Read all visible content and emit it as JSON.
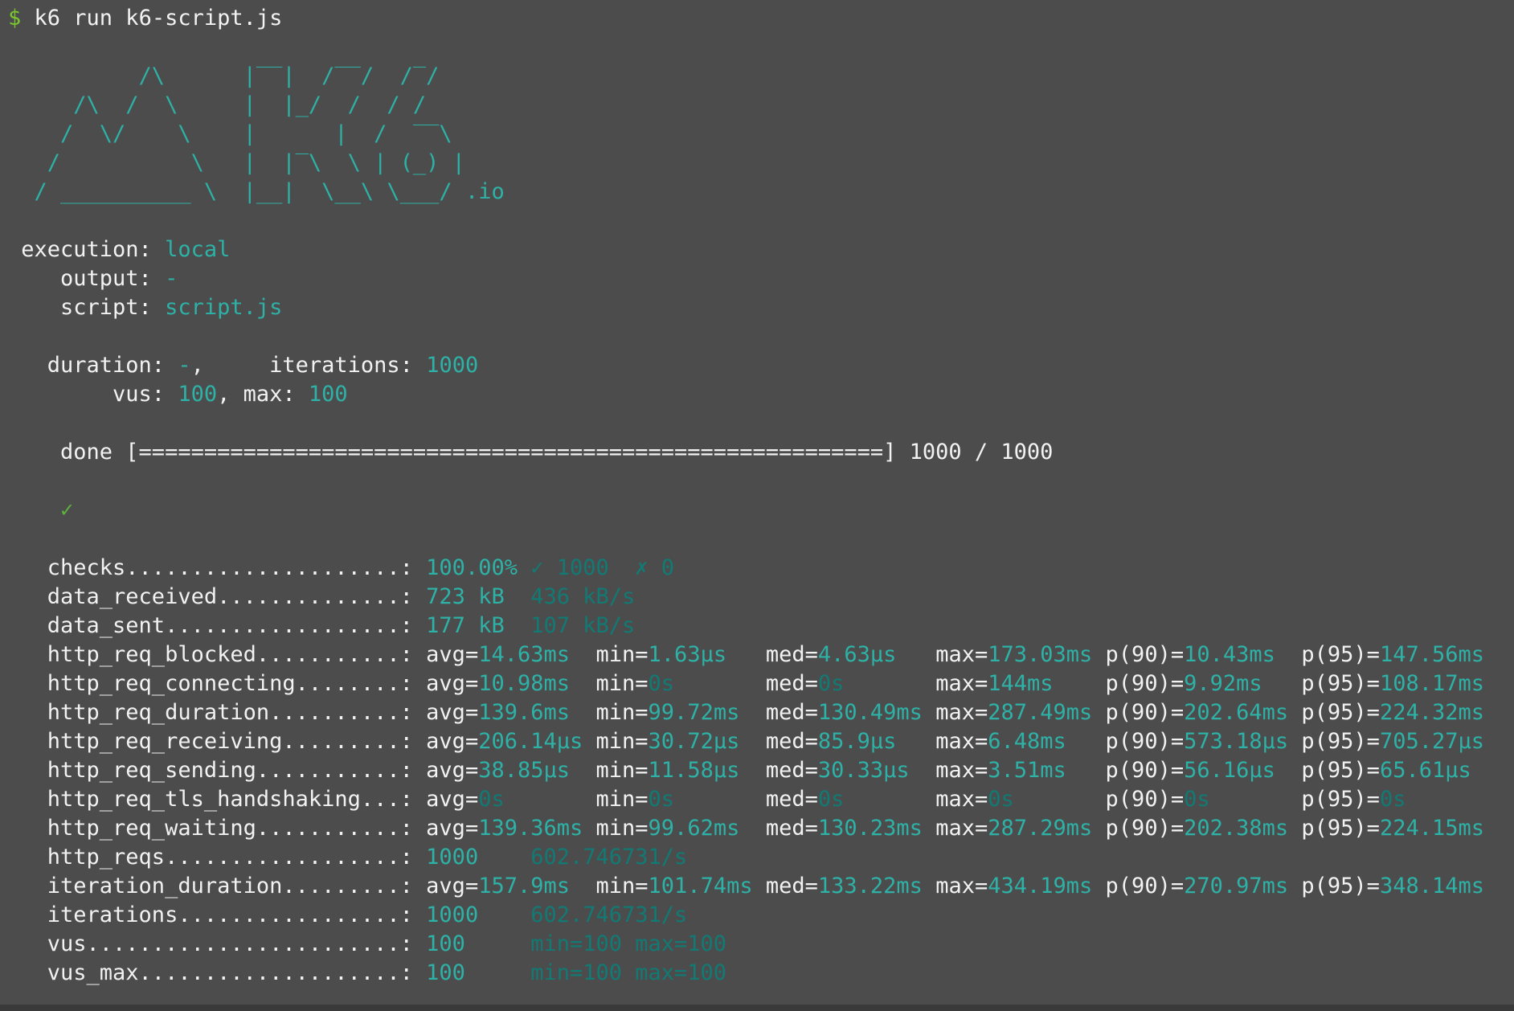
{
  "terminal": {
    "colors": {
      "background": "#4c4c4c",
      "foreground": "#f2f2f2",
      "teal_bright": "#2eb1a6",
      "teal_dim": "#127a74",
      "prompt_green": "#7bc62e",
      "check_green": "#5ab43c"
    },
    "lines": [
      {
        "name": "command-line",
        "segments": [
          {
            "t": "$",
            "c": "green"
          },
          {
            "t": " k6 run k6-script.js",
            "c": "fg"
          }
        ]
      },
      {
        "name": "blank-line",
        "segments": []
      },
      {
        "name": "logo-line-1",
        "segments": [
          {
            "t": "          /\\      |‾‾|  /‾‾/  /‾/   ",
            "c": "teal"
          }
        ]
      },
      {
        "name": "logo-line-2",
        "segments": [
          {
            "t": "     /\\  /  \\     |  |_/  /  / /    ",
            "c": "teal"
          }
        ]
      },
      {
        "name": "logo-line-3",
        "segments": [
          {
            "t": "    /  \\/    \\    |      |  /  ‾‾\\  ",
            "c": "teal"
          }
        ]
      },
      {
        "name": "logo-line-4",
        "segments": [
          {
            "t": "   /          \\   |  |‾\\  \\ | (_) | ",
            "c": "teal"
          }
        ]
      },
      {
        "name": "logo-line-5",
        "segments": [
          {
            "t": "  / __________ \\  |__|  \\__\\ \\___/ .io",
            "c": "teal"
          }
        ]
      },
      {
        "name": "blank-line",
        "segments": []
      },
      {
        "name": "config-execution",
        "segments": [
          {
            "t": " execution: ",
            "c": "fg"
          },
          {
            "t": "local",
            "c": "teal"
          }
        ]
      },
      {
        "name": "config-output",
        "segments": [
          {
            "t": "    output: ",
            "c": "fg"
          },
          {
            "t": "-",
            "c": "teal"
          }
        ]
      },
      {
        "name": "config-script",
        "segments": [
          {
            "t": "    script: ",
            "c": "fg"
          },
          {
            "t": "script.js",
            "c": "teal"
          }
        ]
      },
      {
        "name": "blank-line",
        "segments": []
      },
      {
        "name": "config-duration-iterations",
        "segments": [
          {
            "t": "   duration: ",
            "c": "fg"
          },
          {
            "t": "-",
            "c": "teal"
          },
          {
            "t": ",     iterations: ",
            "c": "fg"
          },
          {
            "t": "1000",
            "c": "teal"
          }
        ]
      },
      {
        "name": "config-vus-max",
        "segments": [
          {
            "t": "        vus: ",
            "c": "fg"
          },
          {
            "t": "100",
            "c": "teal"
          },
          {
            "t": ", max: ",
            "c": "fg"
          },
          {
            "t": "100",
            "c": "teal"
          }
        ]
      },
      {
        "name": "blank-line",
        "segments": []
      },
      {
        "name": "progress-done-line",
        "segments": [
          {
            "t": "    done [=========================================================] 1000 / 1000",
            "c": "fg"
          }
        ]
      },
      {
        "name": "blank-line",
        "segments": []
      },
      {
        "name": "check-pass-line",
        "segments": [
          {
            "t": "    ",
            "c": "fg"
          },
          {
            "t": "✓",
            "c": "check"
          }
        ]
      },
      {
        "name": "blank-line",
        "segments": []
      },
      {
        "name": "metric-checks",
        "segments": [
          {
            "t": "   checks.....................: ",
            "c": "fg"
          },
          {
            "t": "100.00% ",
            "c": "teal"
          },
          {
            "t": "✓ 1000  ",
            "c": "dim"
          },
          {
            "t": "✗ 0",
            "c": "dim"
          }
        ]
      },
      {
        "name": "metric-data-received",
        "segments": [
          {
            "t": "   data_received..............: ",
            "c": "fg"
          },
          {
            "t": "723 kB  ",
            "c": "teal"
          },
          {
            "t": "436 kB/s",
            "c": "dim"
          }
        ]
      },
      {
        "name": "metric-data-sent",
        "segments": [
          {
            "t": "   data_sent..................: ",
            "c": "fg"
          },
          {
            "t": "177 kB  ",
            "c": "teal"
          },
          {
            "t": "107 kB/s",
            "c": "dim"
          }
        ]
      },
      {
        "name": "metric-http-req-blocked",
        "segments": [
          {
            "t": "   http_req_blocked...........: ",
            "c": "fg"
          },
          {
            "t": "avg=",
            "c": "fg"
          },
          {
            "t": "14.63ms  ",
            "c": "teal"
          },
          {
            "t": "min=",
            "c": "fg"
          },
          {
            "t": "1.63µs   ",
            "c": "teal"
          },
          {
            "t": "med=",
            "c": "fg"
          },
          {
            "t": "4.63µs   ",
            "c": "teal"
          },
          {
            "t": "max=",
            "c": "fg"
          },
          {
            "t": "173.03ms ",
            "c": "teal"
          },
          {
            "t": "p(90)=",
            "c": "fg"
          },
          {
            "t": "10.43ms  ",
            "c": "teal"
          },
          {
            "t": "p(95)=",
            "c": "fg"
          },
          {
            "t": "147.56ms",
            "c": "teal"
          }
        ]
      },
      {
        "name": "metric-http-req-connecting",
        "segments": [
          {
            "t": "   http_req_connecting........: ",
            "c": "fg"
          },
          {
            "t": "avg=",
            "c": "fg"
          },
          {
            "t": "10.98ms  ",
            "c": "teal"
          },
          {
            "t": "min=",
            "c": "fg"
          },
          {
            "t": "0s       ",
            "c": "dim"
          },
          {
            "t": "med=",
            "c": "fg"
          },
          {
            "t": "0s       ",
            "c": "dim"
          },
          {
            "t": "max=",
            "c": "fg"
          },
          {
            "t": "144ms    ",
            "c": "teal"
          },
          {
            "t": "p(90)=",
            "c": "fg"
          },
          {
            "t": "9.92ms   ",
            "c": "teal"
          },
          {
            "t": "p(95)=",
            "c": "fg"
          },
          {
            "t": "108.17ms",
            "c": "teal"
          }
        ]
      },
      {
        "name": "metric-http-req-duration",
        "segments": [
          {
            "t": "   http_req_duration..........: ",
            "c": "fg"
          },
          {
            "t": "avg=",
            "c": "fg"
          },
          {
            "t": "139.6ms  ",
            "c": "teal"
          },
          {
            "t": "min=",
            "c": "fg"
          },
          {
            "t": "99.72ms  ",
            "c": "teal"
          },
          {
            "t": "med=",
            "c": "fg"
          },
          {
            "t": "130.49ms ",
            "c": "teal"
          },
          {
            "t": "max=",
            "c": "fg"
          },
          {
            "t": "287.49ms ",
            "c": "teal"
          },
          {
            "t": "p(90)=",
            "c": "fg"
          },
          {
            "t": "202.64ms ",
            "c": "teal"
          },
          {
            "t": "p(95)=",
            "c": "fg"
          },
          {
            "t": "224.32ms",
            "c": "teal"
          }
        ]
      },
      {
        "name": "metric-http-req-receiving",
        "segments": [
          {
            "t": "   http_req_receiving.........: ",
            "c": "fg"
          },
          {
            "t": "avg=",
            "c": "fg"
          },
          {
            "t": "206.14µs ",
            "c": "teal"
          },
          {
            "t": "min=",
            "c": "fg"
          },
          {
            "t": "30.72µs  ",
            "c": "teal"
          },
          {
            "t": "med=",
            "c": "fg"
          },
          {
            "t": "85.9µs   ",
            "c": "teal"
          },
          {
            "t": "max=",
            "c": "fg"
          },
          {
            "t": "6.48ms   ",
            "c": "teal"
          },
          {
            "t": "p(90)=",
            "c": "fg"
          },
          {
            "t": "573.18µs ",
            "c": "teal"
          },
          {
            "t": "p(95)=",
            "c": "fg"
          },
          {
            "t": "705.27µs",
            "c": "teal"
          }
        ]
      },
      {
        "name": "metric-http-req-sending",
        "segments": [
          {
            "t": "   http_req_sending...........: ",
            "c": "fg"
          },
          {
            "t": "avg=",
            "c": "fg"
          },
          {
            "t": "38.85µs  ",
            "c": "teal"
          },
          {
            "t": "min=",
            "c": "fg"
          },
          {
            "t": "11.58µs  ",
            "c": "teal"
          },
          {
            "t": "med=",
            "c": "fg"
          },
          {
            "t": "30.33µs  ",
            "c": "teal"
          },
          {
            "t": "max=",
            "c": "fg"
          },
          {
            "t": "3.51ms   ",
            "c": "teal"
          },
          {
            "t": "p(90)=",
            "c": "fg"
          },
          {
            "t": "56.16µs  ",
            "c": "teal"
          },
          {
            "t": "p(95)=",
            "c": "fg"
          },
          {
            "t": "65.61µs",
            "c": "teal"
          }
        ]
      },
      {
        "name": "metric-http-req-tls-handshaking",
        "segments": [
          {
            "t": "   http_req_tls_handshaking...: ",
            "c": "fg"
          },
          {
            "t": "avg=",
            "c": "fg"
          },
          {
            "t": "0s       ",
            "c": "dim"
          },
          {
            "t": "min=",
            "c": "fg"
          },
          {
            "t": "0s       ",
            "c": "dim"
          },
          {
            "t": "med=",
            "c": "fg"
          },
          {
            "t": "0s       ",
            "c": "dim"
          },
          {
            "t": "max=",
            "c": "fg"
          },
          {
            "t": "0s       ",
            "c": "dim"
          },
          {
            "t": "p(90)=",
            "c": "fg"
          },
          {
            "t": "0s       ",
            "c": "dim"
          },
          {
            "t": "p(95)=",
            "c": "fg"
          },
          {
            "t": "0s",
            "c": "dim"
          }
        ]
      },
      {
        "name": "metric-http-req-waiting",
        "segments": [
          {
            "t": "   http_req_waiting...........: ",
            "c": "fg"
          },
          {
            "t": "avg=",
            "c": "fg"
          },
          {
            "t": "139.36ms ",
            "c": "teal"
          },
          {
            "t": "min=",
            "c": "fg"
          },
          {
            "t": "99.62ms  ",
            "c": "teal"
          },
          {
            "t": "med=",
            "c": "fg"
          },
          {
            "t": "130.23ms ",
            "c": "teal"
          },
          {
            "t": "max=",
            "c": "fg"
          },
          {
            "t": "287.29ms ",
            "c": "teal"
          },
          {
            "t": "p(90)=",
            "c": "fg"
          },
          {
            "t": "202.38ms ",
            "c": "teal"
          },
          {
            "t": "p(95)=",
            "c": "fg"
          },
          {
            "t": "224.15ms",
            "c": "teal"
          }
        ]
      },
      {
        "name": "metric-http-reqs",
        "segments": [
          {
            "t": "   http_reqs..................: ",
            "c": "fg"
          },
          {
            "t": "1000    ",
            "c": "teal"
          },
          {
            "t": "602.746731/s",
            "c": "dim"
          }
        ]
      },
      {
        "name": "metric-iteration-duration",
        "segments": [
          {
            "t": "   iteration_duration.........: ",
            "c": "fg"
          },
          {
            "t": "avg=",
            "c": "fg"
          },
          {
            "t": "157.9ms  ",
            "c": "teal"
          },
          {
            "t": "min=",
            "c": "fg"
          },
          {
            "t": "101.74ms ",
            "c": "teal"
          },
          {
            "t": "med=",
            "c": "fg"
          },
          {
            "t": "133.22ms ",
            "c": "teal"
          },
          {
            "t": "max=",
            "c": "fg"
          },
          {
            "t": "434.19ms ",
            "c": "teal"
          },
          {
            "t": "p(90)=",
            "c": "fg"
          },
          {
            "t": "270.97ms ",
            "c": "teal"
          },
          {
            "t": "p(95)=",
            "c": "fg"
          },
          {
            "t": "348.14ms",
            "c": "teal"
          }
        ]
      },
      {
        "name": "metric-iterations",
        "segments": [
          {
            "t": "   iterations.................: ",
            "c": "fg"
          },
          {
            "t": "1000    ",
            "c": "teal"
          },
          {
            "t": "602.746731/s",
            "c": "dim"
          }
        ]
      },
      {
        "name": "metric-vus",
        "segments": [
          {
            "t": "   vus........................: ",
            "c": "fg"
          },
          {
            "t": "100     ",
            "c": "teal"
          },
          {
            "t": "min=100 max=100",
            "c": "dim"
          }
        ]
      },
      {
        "name": "metric-vus-max",
        "segments": [
          {
            "t": "   vus_max....................: ",
            "c": "fg"
          },
          {
            "t": "100     ",
            "c": "teal"
          },
          {
            "t": "min=100 max=100",
            "c": "dim"
          }
        ]
      }
    ]
  }
}
